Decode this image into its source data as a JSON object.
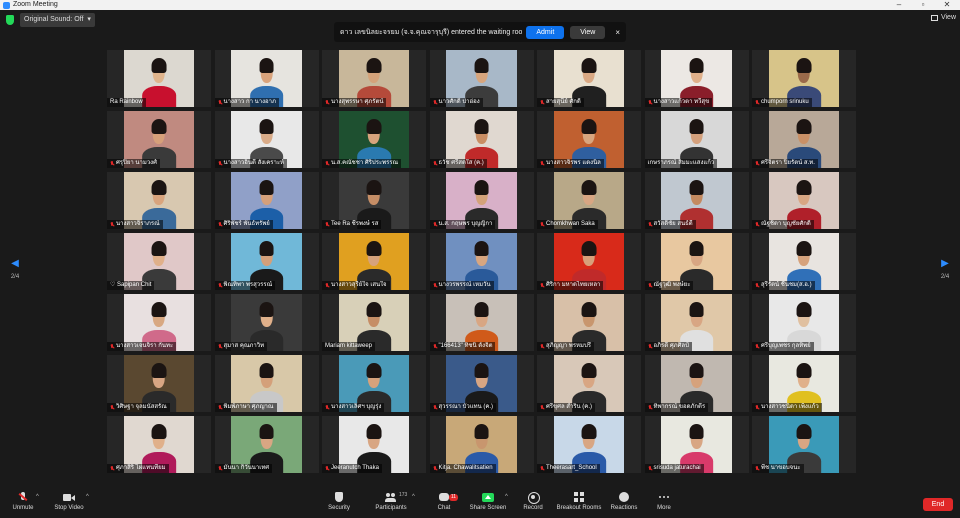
{
  "window": {
    "title": "Zoom Meeting"
  },
  "topbar": {
    "sound_label": "Original Sound: Off",
    "view_label": "View"
  },
  "notification": {
    "message": "ดาว เลขนิลยะจรยม (จ.จ.คุณจารุบุรี) entered the waiting room",
    "admit_label": "Admit",
    "view_label": "View",
    "close_glyph": "×"
  },
  "pagination": {
    "page": "2/4",
    "prev_glyph": "◀",
    "next_glyph": "▶"
  },
  "participants": [
    {
      "name": "Ra Rainbow",
      "muted": false,
      "bg": "#dcd8d0",
      "shirt": "#c8102e",
      "skin": "#e0b48c"
    },
    {
      "name": "นางสาว กา นางอาภ",
      "muted": true,
      "bg": "#e6e4df",
      "shirt": "#2f6fb0",
      "skin": "#d9a37c"
    },
    {
      "name": "นางสุพรรษา ศุภรัตน์",
      "muted": true,
      "bg": "#c8b79a",
      "shirt": "#b54a3a",
      "skin": "#d4a27a"
    },
    {
      "name": "นาวศักดิ์ ปาอ่อง",
      "muted": true,
      "bg": "#a8b8c8",
      "shirt": "#3c3c3c",
      "skin": "#d7a57d"
    },
    {
      "name": "สายสุนีย์ ศักดิ์",
      "muted": true,
      "bg": "#e8e0d0",
      "shirt": "#202020",
      "skin": "#d9a883"
    },
    {
      "name": "นางสาวแก้วตา ทวีสุข",
      "muted": true,
      "bg": "#ece8e4",
      "shirt": "#8a1e2a",
      "skin": "#e0b08a"
    },
    {
      "name": "chumporn srinuku",
      "muted": true,
      "bg": "#d7c489",
      "shirt": "#3a4a78",
      "skin": "#9b6a4a"
    },
    {
      "name": "ศรุปิยา นามวงศ์",
      "muted": true,
      "bg": "#c08a80",
      "shirt": "#3a3a3a",
      "skin": "#d6a07a"
    },
    {
      "name": "นางสาวอินดี สังเคราะห์",
      "muted": true,
      "bg": "#e8e8e8",
      "shirt": "#4a4a4a",
      "skin": "#d9ab88"
    },
    {
      "name": "น.ส.คณัชชา ศิริประพรรณ",
      "muted": true,
      "bg": "#1e5030",
      "shirt": "#2a7ab0",
      "skin": "#d8a37d"
    },
    {
      "name": "ธวัช ศรีสดใส (ค.)",
      "muted": true,
      "bg": "#e0d8d0",
      "shirt": "#c02a2a",
      "skin": "#c98d63"
    },
    {
      "name": "นางสาวจิรพร แดงนิล",
      "muted": true,
      "bg": "#c06030",
      "shirt": "#2f5f9f",
      "skin": "#d8a67f"
    },
    {
      "name": "เกษราภรณ์ สิมมะแสงแก้ว",
      "muted": false,
      "bg": "#d8d8d8",
      "shirt": "#333333",
      "skin": "#d4a07c"
    },
    {
      "name": "ศรีจิตรา ปิยรัตน์ ส.ท.",
      "muted": true,
      "bg": "#b8a898",
      "shirt": "#2a4a7a",
      "skin": "#c99066"
    },
    {
      "name": "นางสาวจิราภรณ์",
      "muted": true,
      "bg": "#d8c8b0",
      "shirt": "#3a6a9a",
      "skin": "#d9a47d"
    },
    {
      "name": "ศิริพัชร์ พันธ์ทรัพย์",
      "muted": true,
      "bg": "#90a0c8",
      "shirt": "#1c5fa8",
      "skin": "#d6a07a"
    },
    {
      "name": "Tee Ra ชีรพงษ์ รส",
      "muted": true,
      "bg": "#3a3a3a",
      "shirt": "#1a1a1a",
      "skin": "#c68e66"
    },
    {
      "name": "น.ส. กฤษพร บุญญิกา",
      "muted": true,
      "bg": "#d8b0c8",
      "shirt": "#2a2a2a",
      "skin": "#d4a27a"
    },
    {
      "name": "Chomkhwan Saka",
      "muted": true,
      "bg": "#b8a888",
      "shirt": "#2a2a2a",
      "skin": "#d8a683"
    },
    {
      "name": "สวัสดิ์ชัย สนธ์ดี",
      "muted": true,
      "bg": "#c0c8d0",
      "shirt": "#b03030",
      "skin": "#c48a60"
    },
    {
      "name": "ณัฐชิดา บุญชัยศักดิ์",
      "muted": true,
      "bg": "#d8c8c0",
      "shirt": "#b0202a",
      "skin": "#d8a683"
    },
    {
      "name": "♡ Sapipan Chit",
      "muted": false,
      "bg": "#e0c8c8",
      "shirt": "#3a3a3a",
      "skin": "#e0b08a"
    },
    {
      "name": "พิณทิพา พรสุวรรณ์",
      "muted": true,
      "bg": "#70b8d8",
      "shirt": "#1a1a1a",
      "skin": "#d4a07a"
    },
    {
      "name": "นางสาวสุรีย์ใจ เสนใจ",
      "muted": true,
      "bg": "#e0a020",
      "shirt": "#2a2a2a",
      "skin": "#d6a27c"
    },
    {
      "name": "นางวรพรรณ์ เหมวัน",
      "muted": true,
      "bg": "#7090c0",
      "shirt": "#2a5a9a",
      "skin": "#d8a680"
    },
    {
      "name": "ศิริกา มหาดไทยเหลา",
      "muted": true,
      "bg": "#d82a1a",
      "shirt": "#c02a2a",
      "skin": "#d8a07a"
    },
    {
      "name": "ณัฐวุฒิ พงษ์ยะ",
      "muted": true,
      "bg": "#e8c8a0",
      "shirt": "#2a2a2a",
      "skin": "#d8a683"
    },
    {
      "name": "สุรีรัตน์ ชื่นชม(ส.อ.)",
      "muted": true,
      "bg": "#e8e4e0",
      "shirt": "#3070b8",
      "skin": "#d6a27c"
    },
    {
      "name": "นางสาวเจนจิรา กันทะ",
      "muted": true,
      "bg": "#e8e0e0",
      "shirt": "#d06a8a",
      "skin": "#d8a882"
    },
    {
      "name": "สุมาส คุณภาวิท",
      "muted": true,
      "bg": "#3a3a3a",
      "shirt": "#2a2a2a",
      "skin": "#e0b08a"
    },
    {
      "name": "Mariam kittaweep",
      "muted": false,
      "bg": "#d8d0b8",
      "shirt": "#2a2a2a",
      "skin": "#c68e66"
    },
    {
      "name": "\"166413\" ทิชนิ ตั้งจิต",
      "muted": true,
      "bg": "#c8c0b8",
      "shirt": "#d05a1a",
      "skin": "#d8a683"
    },
    {
      "name": "สุภิญญา พรหมปรี",
      "muted": true,
      "bg": "#d8c0a8",
      "shirt": "#2a2a2a",
      "skin": "#c8966e"
    },
    {
      "name": "อภิรดี ศุภศิลป์",
      "muted": true,
      "bg": "#e0c8a8",
      "shirt": "#e0e0e0",
      "skin": "#d8a683"
    },
    {
      "name": "ศรีบุญเพชร กุลทิพย์",
      "muted": true,
      "bg": "#e8e8e8",
      "shirt": "#d8d8d8",
      "skin": "#e0c0a0"
    },
    {
      "name": "วิศิษฐา จุลมนัสสรัณ",
      "muted": true,
      "bg": "#5a4830",
      "shirt": "#2a2a2a",
      "skin": "#d8a683"
    },
    {
      "name": "พิมพ์ภาษา ศุภญาณ",
      "muted": true,
      "bg": "#d8c8a8",
      "shirt": "#c8c8c8",
      "skin": "#d4a07a"
    },
    {
      "name": "นางสาวเลิศฯ บุญรุ่ง",
      "muted": true,
      "bg": "#4a9ab8",
      "shirt": "#2a2a2a",
      "skin": "#d6a27c"
    },
    {
      "name": "สุวรรณา บัวแทน (ค.)",
      "muted": true,
      "bg": "#3a5a8a",
      "shirt": "#1a1a1a",
      "skin": "#d8a683"
    },
    {
      "name": "ศรีขุศล สำริน (ค.)",
      "muted": true,
      "bg": "#d8c8b8",
      "shirt": "#2a2a2a",
      "skin": "#d8a683"
    },
    {
      "name": "ทิพากรณ์ ขอดภักดีร",
      "muted": true,
      "bg": "#c0b8b0",
      "shirt": "#2a2a2a",
      "skin": "#d6a27c"
    },
    {
      "name": "นางสาวชนิดา เพ็งแก้ว",
      "muted": true,
      "bg": "#e8e8e0",
      "shirt": "#e0c020",
      "skin": "#e0b08a"
    },
    {
      "name": "ศุภาสิริ ไผ่แทนที่ยม",
      "muted": true,
      "bg": "#e0d8d0",
      "shirt": "#b01a5a",
      "skin": "#e0b08a"
    },
    {
      "name": "มันนา กิวันนาเทศ",
      "muted": true,
      "bg": "#7aa878",
      "shirt": "#1a1a1a",
      "skin": "#d8a683"
    },
    {
      "name": "Jeeranutch Thaka",
      "muted": true,
      "bg": "#e8e8e8",
      "shirt": "#1a1a1a",
      "skin": "#d8a683"
    },
    {
      "name": "Kitja. Chawalitsatien",
      "muted": true,
      "bg": "#c8a878",
      "shirt": "#2a5aa8",
      "skin": "#c8966e"
    },
    {
      "name": "Theerasart_School",
      "muted": true,
      "bg": "#c8d8e8",
      "shirt": "#2a5aa8",
      "skin": "#d8a683"
    },
    {
      "name": "srisuda jaturachai",
      "muted": true,
      "bg": "#e8e8e0",
      "shirt": "#d83a6a",
      "skin": "#d8a683"
    },
    {
      "name": "พีช นาขอบจนะ",
      "muted": true,
      "bg": "#3a9ab8",
      "shirt": "#3a3a3a",
      "skin": "#d8a683"
    }
  ],
  "toolbar": {
    "unmute_label": "Unmute",
    "stop_video_label": "Stop Video",
    "security_label": "Security",
    "participants_label": "Participants",
    "participants_count": "173",
    "chat_label": "Chat",
    "chat_badge": "11",
    "share_label": "Share Screen",
    "record_label": "Record",
    "breakout_label": "Breakout Rooms",
    "reactions_label": "Reactions",
    "more_label": "More",
    "end_label": "End",
    "caret_glyph": "^"
  },
  "colors": {
    "accent": "#0e72ed",
    "danger": "#e02828",
    "share": "#23d959",
    "bg": "#1a1a1a"
  },
  "icons": {
    "app": "zoom-icon",
    "security": "shield-icon",
    "participants": "people-icon",
    "chat": "chat-icon",
    "share": "share-screen-icon",
    "record": "record-icon",
    "breakout": "breakout-rooms-icon",
    "reactions": "reaction-icon",
    "more": "more-icon"
  }
}
